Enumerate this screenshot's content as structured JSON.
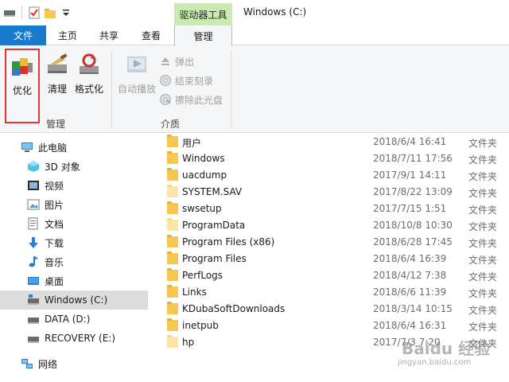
{
  "titlebar": {
    "context_tab_group": "驱动器工具",
    "window_title": "Windows (C:)"
  },
  "tabs": {
    "file": "文件",
    "home": "主页",
    "share": "共享",
    "view": "查看",
    "manage": "管理"
  },
  "ribbon": {
    "manage_group": {
      "label": "管理",
      "optimize": "优化",
      "cleanup": "清理",
      "format": "格式化"
    },
    "media_group": {
      "label": "介质",
      "autoplay": "自动播放",
      "eject": "弹出",
      "finish_burning": "结束刻录",
      "erase_disc": "擦除此光盘"
    }
  },
  "nav": {
    "items": [
      {
        "label": "此电脑",
        "icon": "computer-icon"
      },
      {
        "label": "3D 对象",
        "icon": "3d-objects-icon"
      },
      {
        "label": "视频",
        "icon": "video-icon"
      },
      {
        "label": "图片",
        "icon": "pictures-icon"
      },
      {
        "label": "文档",
        "icon": "documents-icon"
      },
      {
        "label": "下载",
        "icon": "download-icon"
      },
      {
        "label": "音乐",
        "icon": "music-icon"
      },
      {
        "label": "桌面",
        "icon": "desktop-icon"
      },
      {
        "label": "Windows (C:)",
        "icon": "drive-c-icon"
      },
      {
        "label": "DATA (D:)",
        "icon": "drive-icon"
      },
      {
        "label": "RECOVERY (E:)",
        "icon": "drive-icon"
      },
      {
        "label": "网络",
        "icon": "network-icon"
      }
    ]
  },
  "files": [
    {
      "name": "用户",
      "date": "2018/6/4 16:41",
      "type": "文件夹"
    },
    {
      "name": "Windows",
      "date": "2018/7/11 17:56",
      "type": "文件夹"
    },
    {
      "name": "uacdump",
      "date": "2017/9/1 14:11",
      "type": "文件夹"
    },
    {
      "name": "SYSTEM.SAV",
      "date": "2017/8/22 13:09",
      "type": "文件夹"
    },
    {
      "name": "swsetup",
      "date": "2017/7/15 1:51",
      "type": "文件夹"
    },
    {
      "name": "ProgramData",
      "date": "2018/10/8 10:30",
      "type": "文件夹"
    },
    {
      "name": "Program Files (x86)",
      "date": "2018/6/28 17:45",
      "type": "文件夹"
    },
    {
      "name": "Program Files",
      "date": "2018/6/4 16:39",
      "type": "文件夹"
    },
    {
      "name": "PerfLogs",
      "date": "2018/4/12 7:38",
      "type": "文件夹"
    },
    {
      "name": "Links",
      "date": "2018/6/6 11:39",
      "type": "文件夹"
    },
    {
      "name": "KDubaSoftDownloads",
      "date": "2018/3/14 10:15",
      "type": "文件夹"
    },
    {
      "name": "inetpub",
      "date": "2018/6/4 16:31",
      "type": "文件夹"
    },
    {
      "name": "hp",
      "date": "2017/7/3 7:20",
      "type": "文件夹"
    }
  ],
  "watermark": {
    "main": "Baidu 经验",
    "sub": "jingyan.baidu.com"
  },
  "colors": {
    "file_tab": "#1979ca",
    "context_tab": "#c9ebb1",
    "folder": "#f7c752",
    "highlight_border": "#e23535",
    "selected_nav": "#dcdcdc"
  }
}
